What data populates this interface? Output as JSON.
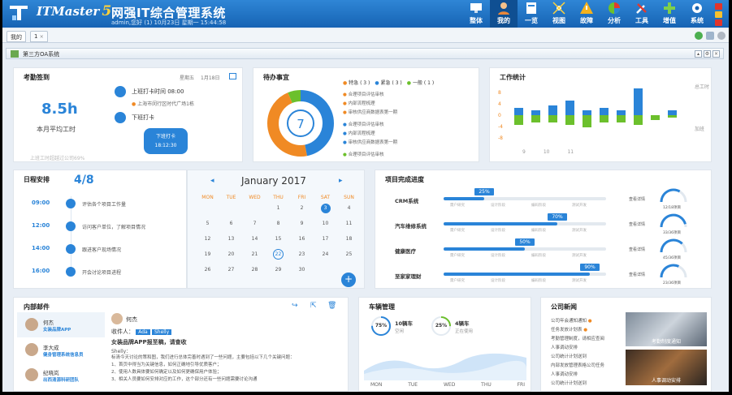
{
  "header": {
    "brand": "ITMaster",
    "version": "5",
    "title": "网强IT综合管理系统",
    "user_line": "admin,您好 (1) 10月23日 星期一 15:44:58",
    "nav": [
      {
        "label": "整体",
        "icon": "monitor-icon"
      },
      {
        "label": "我的",
        "icon": "user-icon"
      },
      {
        "label": "一览",
        "icon": "overview-icon"
      },
      {
        "label": "视图",
        "icon": "topology-icon"
      },
      {
        "label": "故障",
        "icon": "warning-icon"
      },
      {
        "label": "分析",
        "icon": "pie-icon"
      },
      {
        "label": "工具",
        "icon": "tools-icon"
      },
      {
        "label": "增值",
        "icon": "plus-icon"
      },
      {
        "label": "系统",
        "icon": "gear-icon"
      }
    ]
  },
  "tabs": [
    {
      "label": "我的"
    },
    {
      "label": "1"
    }
  ],
  "window_title": "第三方OA系统",
  "checkin": {
    "title": "考勤签到",
    "date_label": "星期五",
    "date": "1月18日",
    "hours": "8.5h",
    "hours_label": "本月平均工时",
    "start_label": "上班打卡时间 08:00",
    "location": "上海市闵行区时代广场1栋",
    "end_label": "下班打卡",
    "btn_label": "下班打卡",
    "btn_time": "18:12:30",
    "footer": "上班工时超越过公司69%"
  },
  "todo": {
    "title": "待办事宜",
    "count": "7",
    "legend": [
      {
        "label": "特急 ( 3 )",
        "color": "#f08a24"
      },
      {
        "label": "紧急 ( 3 )",
        "color": "#2a84d8"
      },
      {
        "label": "一般 ( 1 )",
        "color": "#6cc02c"
      }
    ],
    "items": [
      {
        "text": "合理项目评估审核",
        "color": "#f08a24"
      },
      {
        "text": "内部流程梳理",
        "color": "#f08a24"
      },
      {
        "text": "审核供应商数据表第一期",
        "color": "#f08a24"
      },
      {
        "text": "合理项目评估审核",
        "color": "#2a84d8"
      },
      {
        "text": "内部流程梳理",
        "color": "#2a84d8"
      },
      {
        "text": "审核供应商数据表第一期",
        "color": "#2a84d8"
      },
      {
        "text": "合理项目评估审核",
        "color": "#6cc02c"
      }
    ]
  },
  "work": {
    "title": "工作统计",
    "y_ticks": [
      "8",
      "4",
      "0",
      "-4",
      "-8"
    ],
    "x_ticks": [
      "9",
      "10",
      "11"
    ],
    "side_top": "总工时",
    "side_bottom": "加班"
  },
  "schedule": {
    "title": "日程安排",
    "count": "4/8",
    "items": [
      {
        "time": "09:00",
        "text": "评估各个项目工作量"
      },
      {
        "time": "12:00",
        "text": "访问客户单位，了解项目情况"
      },
      {
        "time": "14:00",
        "text": "跟进客户现场情况"
      },
      {
        "time": "16:00",
        "text": "开会讨论项目进程"
      }
    ]
  },
  "calendar": {
    "month": "January 2017",
    "prev": "◂",
    "next": "▸",
    "weekdays": [
      "MON",
      "TUE",
      "WED",
      "THU",
      "FRI",
      "SAT",
      "SUN"
    ],
    "rows": [
      [
        "",
        "",
        "",
        "",
        "",
        "",
        ""
      ],
      [
        "",
        "",
        "",
        "1",
        "2",
        "3",
        "4"
      ],
      [
        "5",
        "6",
        "7",
        "8",
        "9",
        "10",
        "11"
      ],
      [
        "12",
        "13",
        "14",
        "15",
        "16",
        "17",
        "18"
      ],
      [
        "19",
        "20",
        "21",
        "22",
        "23",
        "24",
        "25"
      ],
      [
        "26",
        "27",
        "28",
        "29",
        "30",
        "",
        ""
      ]
    ],
    "add": "+"
  },
  "progress": {
    "title": "项目完成进度",
    "projects": [
      {
        "name": "CRM系统",
        "pct": 25,
        "pct_label": "25%",
        "phases": [
          "需户研究",
          "设计阶段",
          "编码阶段",
          "测试开发"
        ],
        "gauge_label": "查看详情",
        "gauge_value": "12/18项目",
        "gauge_pct": 0.67
      },
      {
        "name": "汽车维修系统",
        "pct": 70,
        "pct_label": "70%",
        "phases": [
          "需户研究",
          "设计阶段",
          "编码阶段",
          "测试开发"
        ],
        "gauge_label": "查看详情",
        "gauge_value": "33/36项目",
        "gauge_pct": 0.92
      },
      {
        "name": "健康医疗",
        "pct": 50,
        "pct_label": "50%",
        "phases": [
          "需户研究",
          "设计阶段",
          "编码阶段",
          "测试开发"
        ],
        "gauge_label": "查看详情",
        "gauge_value": "45/36项目",
        "gauge_pct": 0.75
      },
      {
        "name": "至家家理财",
        "pct": 90,
        "pct_label": "90%",
        "phases": [
          "需户研究",
          "设计阶段",
          "编码阶段",
          "测试开发"
        ],
        "gauge_label": "查看详情",
        "gauge_value": "23/36项目",
        "gauge_pct": 0.64
      }
    ]
  },
  "mail": {
    "title": "内部邮件",
    "list": [
      {
        "name": "何杰",
        "subject": "女装品牌APP"
      },
      {
        "name": "李大成",
        "subject": "健身管理系统信息员"
      },
      {
        "name": "纪晓岚",
        "subject": "出西清源科研团队"
      }
    ],
    "from": "何杰",
    "to_label": "收件人：",
    "to": [
      "Ada",
      "Shelly"
    ],
    "subject": "女装品牌APP报至稿，请查收",
    "greeting": "Shelly：",
    "body": [
      "标清今天讨论的策和图，我们进行总体完善时遇到了一些问题，主要包括以下几个关键问题：",
      "1、首页中得当为关键信息，如何正确地引导优质客户；",
      "2、使用人数具体要如何确定以及如何更确保用户体验；",
      "3、相关人员要如何安排对应的工作，这个部分还有一些问题需要讨论沟通"
    ]
  },
  "vehicle": {
    "title": "车辆管理",
    "stats": [
      {
        "pct": "75%",
        "count": "10辆车",
        "state": "空闲",
        "pct_val": 0.75
      },
      {
        "pct": "25%",
        "count": "4辆车",
        "state": "正在使用",
        "pct_val": 0.25
      }
    ],
    "days": [
      "MON",
      "TUE",
      "WED",
      "THU",
      "FRI"
    ]
  },
  "news": {
    "title": "公司新闻",
    "items": [
      "公司年会通知通知",
      "任务发放计划表",
      "考勤管理制度，请相应查阅",
      "人事调动安排",
      "公司统计计划送到",
      "内部发放管理表格公司任务",
      "人事调动安排",
      "公司统计计划送到"
    ],
    "captions": [
      "考勤制度通知",
      "人事调动安排"
    ]
  },
  "colors": {
    "accent": "#2a84d8",
    "orange": "#f08a24",
    "green": "#6cc02c"
  }
}
